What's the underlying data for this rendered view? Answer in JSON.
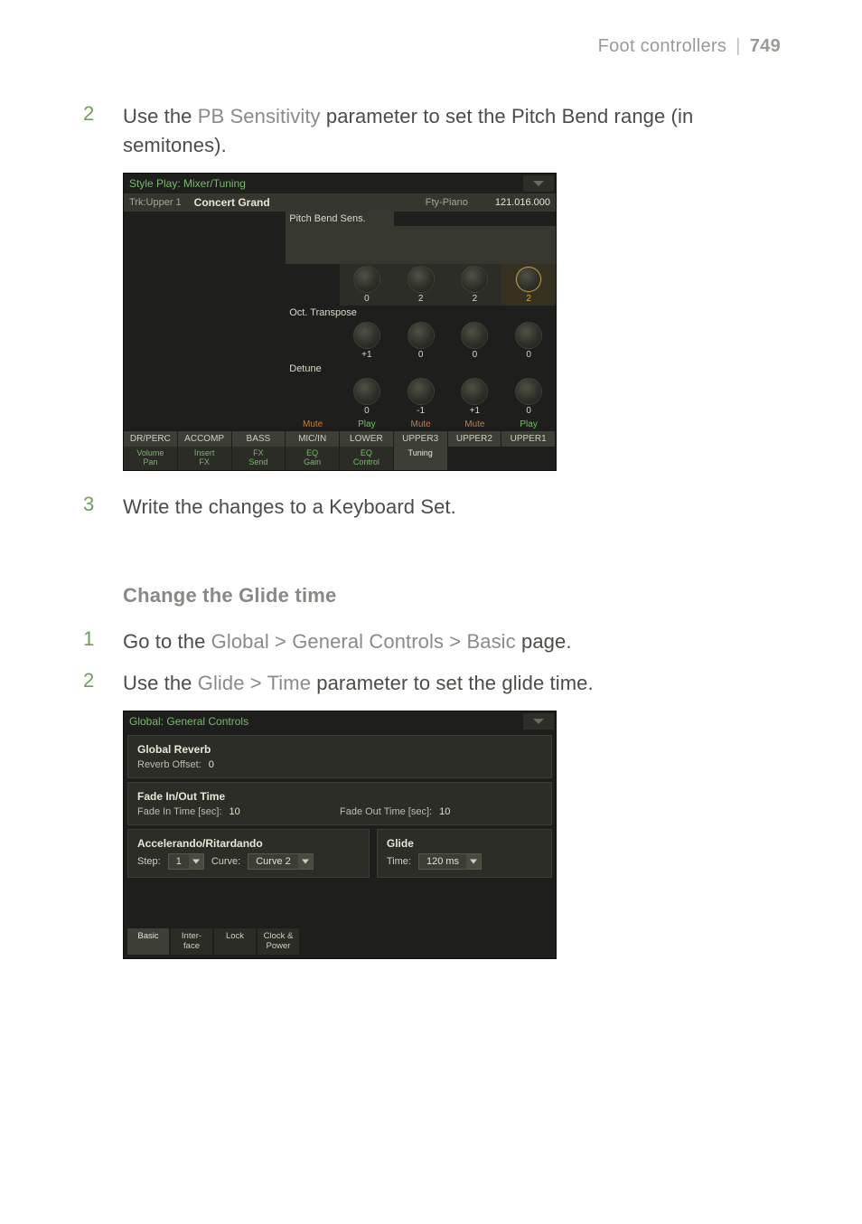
{
  "header": {
    "section": "Foot controllers",
    "page": "749"
  },
  "step2a": {
    "num": "2",
    "pre": "Use the ",
    "param": "PB Sensitivity",
    "post": " parameter to set the Pitch Bend range (in semitones)."
  },
  "step3": {
    "num": "3",
    "text": "Write the changes to a Keyboard Set."
  },
  "sectionTitle": "Change the Glide time",
  "step1b": {
    "num": "1",
    "pre": "Go to the ",
    "param": "Global > General Controls > Basic",
    "post": " page."
  },
  "step2b": {
    "num": "2",
    "pre": "Use the ",
    "param": "Glide > Time",
    "post": " parameter to set the glide time."
  },
  "scr1": {
    "title": "Style Play: Mixer/Tuning",
    "trkLabel": "Trk:",
    "trkVal": "Upper 1",
    "sound": "Concert Grand",
    "fty": "Fty-Piano",
    "bank": "121.016.000",
    "rowLabels": [
      "Pitch Bend Sens.",
      "Oct. Transpose",
      "Detune"
    ],
    "knobRows": [
      [
        null,
        null,
        null,
        null,
        {
          "v": "0"
        },
        {
          "v": "2"
        },
        {
          "v": "2"
        },
        {
          "v": "2",
          "sel": true
        }
      ],
      [
        null,
        null,
        null,
        null,
        {
          "v": "+1"
        },
        {
          "v": "0"
        },
        {
          "v": "0"
        },
        {
          "v": "0"
        }
      ],
      [
        null,
        null,
        null,
        null,
        {
          "v": "0"
        },
        {
          "v": "-1"
        },
        {
          "v": "+1"
        },
        {
          "v": "0"
        }
      ]
    ],
    "muteplay": [
      "",
      "",
      "",
      "Mute",
      "Play",
      "Mute",
      "Mute",
      "Play"
    ],
    "trackHeads": [
      "DR/PERC",
      "ACCOMP",
      "BASS",
      "MIC/IN",
      "LOWER",
      "UPPER3",
      "UPPER2",
      "UPPER1"
    ],
    "tabs": [
      {
        "l1": "Volume",
        "l2": "Pan"
      },
      {
        "l1": "Insert",
        "l2": "FX"
      },
      {
        "l1": "FX",
        "l2": "Send"
      },
      {
        "l1": "EQ",
        "l2": "Gain"
      },
      {
        "l1": "EQ",
        "l2": "Control"
      },
      {
        "l1": "Tuning",
        "l2": "",
        "active": true
      },
      {
        "l1": "",
        "l2": ""
      },
      {
        "l1": "",
        "l2": ""
      }
    ]
  },
  "scr2": {
    "title": "Global: General Controls",
    "globalReverb": {
      "head": "Global Reverb",
      "label": "Reverb Offset:",
      "val": "0"
    },
    "fade": {
      "head": "Fade In/Out Time",
      "inLabel": "Fade In Time [sec]:",
      "inVal": "10",
      "outLabel": "Fade Out Time [sec]:",
      "outVal": "10"
    },
    "accel": {
      "head": "Accelerando/Ritardando",
      "stepLabel": "Step:",
      "stepVal": "1",
      "curveLabel": "Curve:",
      "curveVal": "Curve 2"
    },
    "glide": {
      "head": "Glide",
      "timeLabel": "Time:",
      "timeVal": "120 ms"
    },
    "tabs": [
      {
        "l": "Basic",
        "active": true
      },
      {
        "l": "Inter-\nface"
      },
      {
        "l": "Lock"
      },
      {
        "l": "Clock &\nPower"
      }
    ]
  }
}
